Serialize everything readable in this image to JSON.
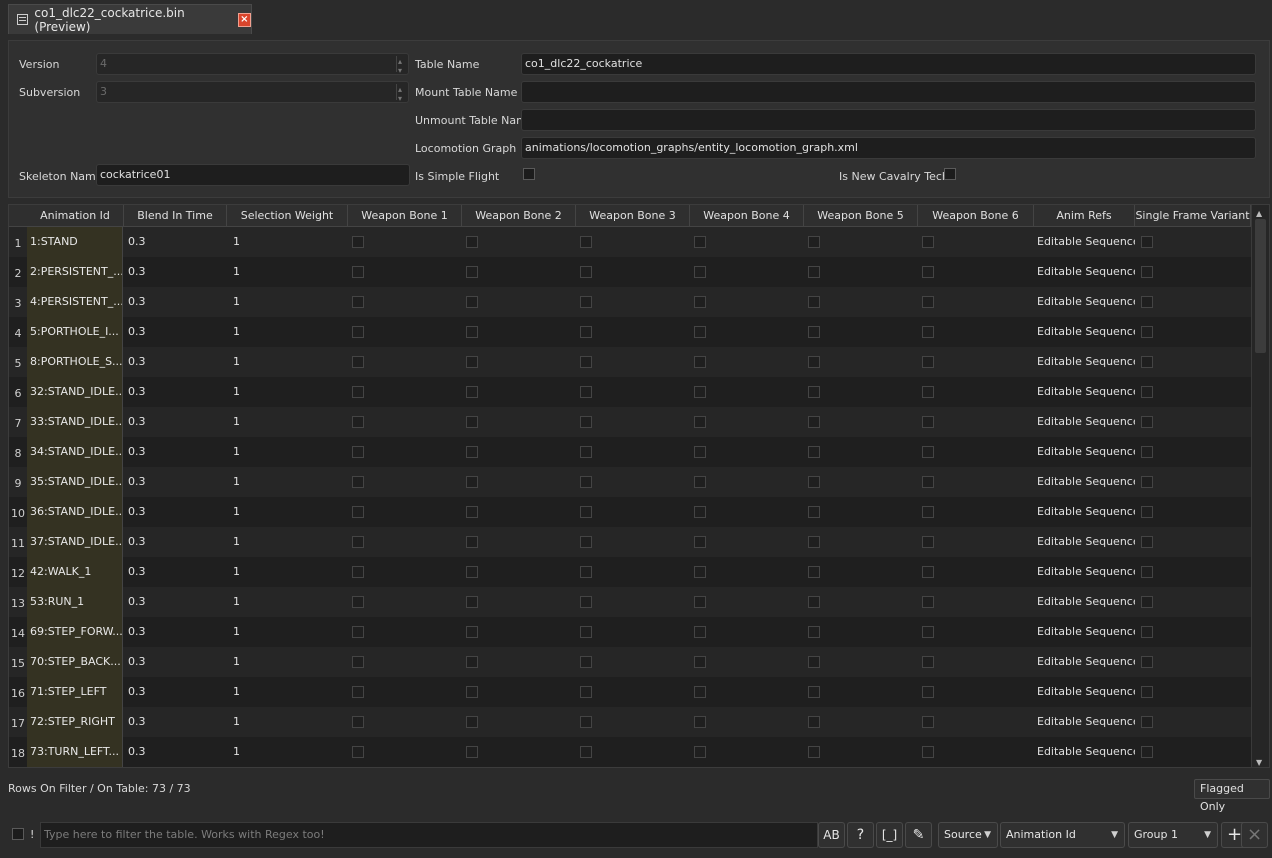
{
  "tab": {
    "title": "co1_dlc22_cockatrice.bin (Preview)",
    "close": "×"
  },
  "form": {
    "version_label": "Version",
    "version_value": "4",
    "subversion_label": "Subversion",
    "subversion_value": "3",
    "skeleton_label": "Skeleton Name",
    "skeleton_value": "cockatrice01",
    "table_name_label": "Table Name",
    "table_name_value": "co1_dlc22_cockatrice",
    "mount_label": "Mount Table Name",
    "mount_value": "",
    "unmount_label": "Unmount Table Name",
    "unmount_value": "",
    "locomotion_label": "Locomotion Graph",
    "locomotion_value": "animations/locomotion_graphs/entity_locomotion_graph.xml",
    "simple_flight_label": "Is Simple Flight",
    "cavalry_label": "Is New Cavalry Tech"
  },
  "table": {
    "columns": [
      "Animation Id",
      "Blend In Time",
      "Selection Weight",
      "Weapon Bone 1",
      "Weapon Bone 2",
      "Weapon Bone 3",
      "Weapon Bone 4",
      "Weapon Bone 5",
      "Weapon Bone 6",
      "Anim Refs",
      "Single Frame Variant"
    ],
    "rows": [
      {
        "n": "1",
        "id": "1:STAND",
        "blend": "0.3",
        "weight": "1",
        "refs": "Editable Sequence"
      },
      {
        "n": "2",
        "id": "2:PERSISTENT_...",
        "blend": "0.3",
        "weight": "1",
        "refs": "Editable Sequence"
      },
      {
        "n": "3",
        "id": "4:PERSISTENT_...",
        "blend": "0.3",
        "weight": "1",
        "refs": "Editable Sequence"
      },
      {
        "n": "4",
        "id": "5:PORTHOLE_I...",
        "blend": "0.3",
        "weight": "1",
        "refs": "Editable Sequence"
      },
      {
        "n": "5",
        "id": "8:PORTHOLE_S...",
        "blend": "0.3",
        "weight": "1",
        "refs": "Editable Sequence"
      },
      {
        "n": "6",
        "id": "32:STAND_IDLE...",
        "blend": "0.3",
        "weight": "1",
        "refs": "Editable Sequence"
      },
      {
        "n": "7",
        "id": "33:STAND_IDLE...",
        "blend": "0.3",
        "weight": "1",
        "refs": "Editable Sequence"
      },
      {
        "n": "8",
        "id": "34:STAND_IDLE...",
        "blend": "0.3",
        "weight": "1",
        "refs": "Editable Sequence"
      },
      {
        "n": "9",
        "id": "35:STAND_IDLE...",
        "blend": "0.3",
        "weight": "1",
        "refs": "Editable Sequence"
      },
      {
        "n": "10",
        "id": "36:STAND_IDLE...",
        "blend": "0.3",
        "weight": "1",
        "refs": "Editable Sequence"
      },
      {
        "n": "11",
        "id": "37:STAND_IDLE...",
        "blend": "0.3",
        "weight": "1",
        "refs": "Editable Sequence"
      },
      {
        "n": "12",
        "id": "42:WALK_1",
        "blend": "0.3",
        "weight": "1",
        "refs": "Editable Sequence"
      },
      {
        "n": "13",
        "id": "53:RUN_1",
        "blend": "0.3",
        "weight": "1",
        "refs": "Editable Sequence"
      },
      {
        "n": "14",
        "id": "69:STEP_FORW...",
        "blend": "0.3",
        "weight": "1",
        "refs": "Editable Sequence"
      },
      {
        "n": "15",
        "id": "70:STEP_BACK...",
        "blend": "0.3",
        "weight": "1",
        "refs": "Editable Sequence"
      },
      {
        "n": "16",
        "id": "71:STEP_LEFT",
        "blend": "0.3",
        "weight": "1",
        "refs": "Editable Sequence"
      },
      {
        "n": "17",
        "id": "72:STEP_RIGHT",
        "blend": "0.3",
        "weight": "1",
        "refs": "Editable Sequence"
      },
      {
        "n": "18",
        "id": "73:TURN_LEFT...",
        "blend": "0.3",
        "weight": "1",
        "refs": "Editable Sequence"
      }
    ]
  },
  "status": {
    "rows_text": "Rows On Filter / On Table: 73 / 73",
    "flagged_label": "Flagged Only"
  },
  "filter": {
    "negate_label": "!",
    "placeholder": "Type here to filter the table. Works with Regex too!",
    "case_button": "AB",
    "regex_button": "?",
    "brackets_button": "[_]",
    "source_value": "Source",
    "column_value": "Animation Id",
    "group_value": "Group 1",
    "add_button": "+",
    "remove_button": "×"
  }
}
